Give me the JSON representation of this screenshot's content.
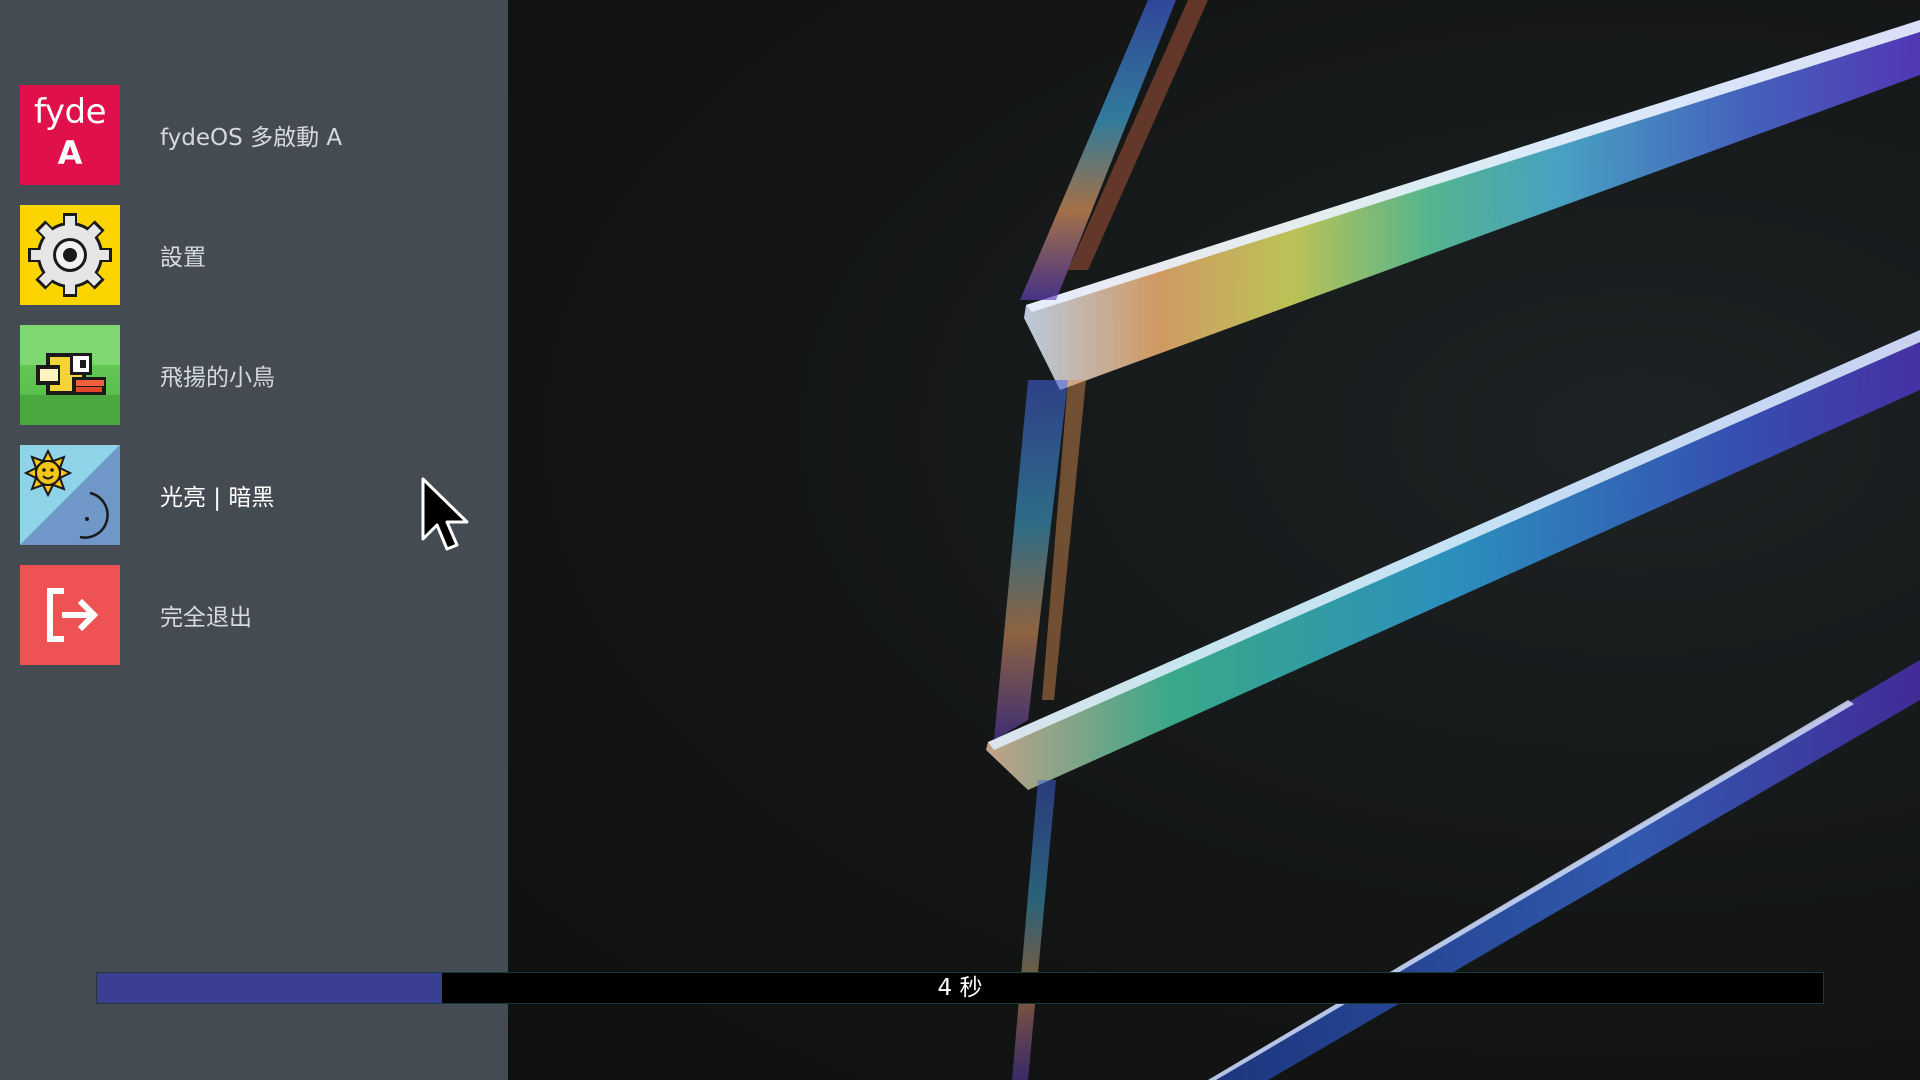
{
  "menu": {
    "items": [
      {
        "id": "fydeos",
        "label": "fydeOS 多啟動 A",
        "icon": "fydeos-logo-icon",
        "icon_text_1": "fyde",
        "icon_text_2": "A",
        "tile_color": "#e0104a"
      },
      {
        "id": "settings",
        "label": "設置",
        "icon": "gear-icon",
        "tile_color": "#fcd400"
      },
      {
        "id": "flappy",
        "label": "飛揚的小鳥",
        "icon": "bird-icon",
        "tile_color": "#5ec24f"
      },
      {
        "id": "theme",
        "label": "光亮 | 暗黑",
        "icon": "sun-moon-icon",
        "tile_color": "#8fd3e8",
        "active": true
      },
      {
        "id": "exit",
        "label": "完全退出",
        "icon": "exit-icon",
        "tile_color": "#ee5253"
      }
    ]
  },
  "countdown": {
    "text": "4 秒",
    "progress": 0.2,
    "fill_color": "#3b3f94"
  },
  "colors": {
    "sidebar": "#454b53",
    "background": "#111213"
  }
}
